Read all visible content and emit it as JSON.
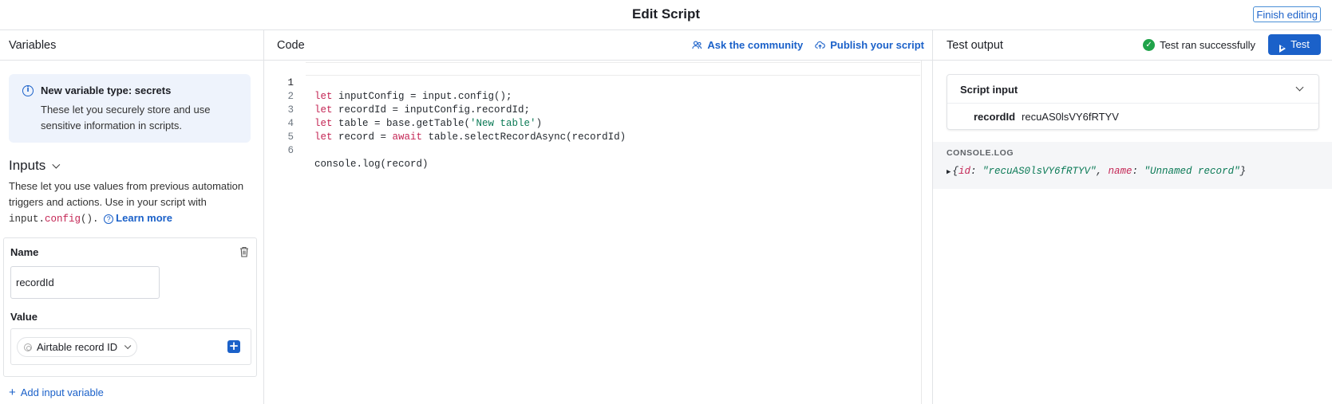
{
  "header": {
    "title": "Edit Script",
    "finish_label": "Finish editing"
  },
  "variables": {
    "title": "Variables",
    "notice": {
      "title": "New variable type: secrets",
      "body": "These let you securely store and use sensitive information in scripts."
    },
    "inputs": {
      "heading": "Inputs",
      "desc_prefix": "These let you use values from previous automation triggers and actions. Use in your script with",
      "code_obj": "input.",
      "code_fn": "config",
      "code_parens": "().",
      "learn_more": "Learn more"
    },
    "input_item": {
      "name_label": "Name",
      "name_value": "recordId",
      "value_label": "Value",
      "token_label": "Airtable record ID"
    },
    "add_label": "Add input variable"
  },
  "code": {
    "title": "Code",
    "ask_label": "Ask the community",
    "publish_label": "Publish your script",
    "lines": [
      {
        "n": "1",
        "kw": "let",
        "rest": " inputConfig = input.config();"
      },
      {
        "n": "2",
        "kw": "let",
        "rest": " recordId = inputConfig.recordId;"
      },
      {
        "n": "3",
        "kw": "let",
        "rest": " table = base.getTable(",
        "str": "'New table'",
        "tail": ")"
      },
      {
        "n": "4",
        "kw": "let",
        "rest": " record = ",
        "kw2": "await",
        "tail": " table.selectRecordAsync(recordId)"
      },
      {
        "n": "5"
      },
      {
        "n": "6",
        "plain": "console.log(record)"
      }
    ]
  },
  "output": {
    "title": "Test output",
    "status": "Test ran successfully",
    "test_label": "Test",
    "script_input": {
      "title": "Script input",
      "key": "recordId",
      "value": "recuAS0lsVY6fRTYV"
    },
    "console": {
      "heading": "CONSOLE.LOG",
      "open": "{",
      "k1": "id",
      "v1": "\"recuAS0lsVY6fRTYV\"",
      "k2": "name",
      "v2": "\"Unnamed record\"",
      "close": "}"
    }
  },
  "colors": {
    "accent": "#1b61c9",
    "success": "#20a34a",
    "keyword": "#c42655",
    "string": "#0b7a56"
  }
}
